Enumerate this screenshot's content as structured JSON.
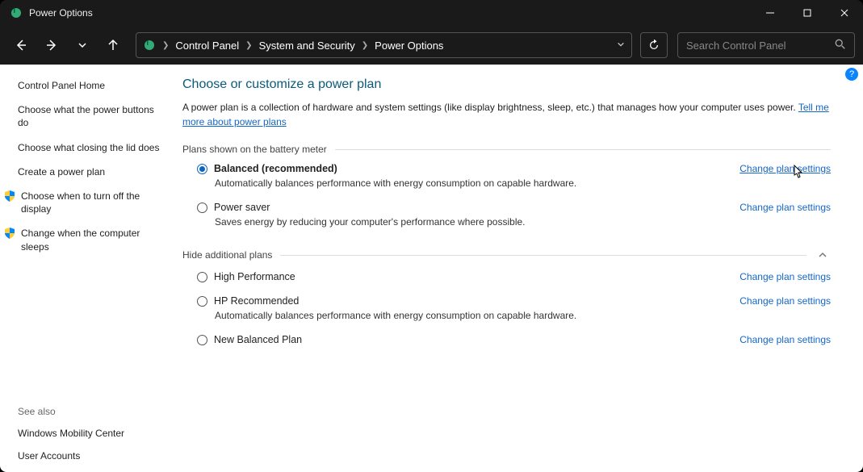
{
  "window": {
    "title": "Power Options"
  },
  "breadcrumb": {
    "items": [
      "Control Panel",
      "System and Security",
      "Power Options"
    ]
  },
  "search": {
    "placeholder": "Search Control Panel"
  },
  "sidebar": {
    "home": "Control Panel Home",
    "links": [
      "Choose what the power buttons do",
      "Choose what closing the lid does",
      "Create a power plan",
      "Choose when to turn off the display",
      "Change when the computer sleeps"
    ],
    "seealso_label": "See also",
    "seealso": [
      "Windows Mobility Center",
      "User Accounts"
    ]
  },
  "main": {
    "heading": "Choose or customize a power plan",
    "intro_prefix": "A power plan is a collection of hardware and system settings (like display brightness, sleep, etc.) that manages how your computer uses power. ",
    "intro_link": "Tell me more about power plans",
    "section1": "Plans shown on the battery meter",
    "section2": "Hide additional plans",
    "change_label": "Change plan settings",
    "plans_primary": [
      {
        "name": "Balanced (recommended)",
        "desc": "Automatically balances performance with energy consumption on capable hardware.",
        "selected": true
      },
      {
        "name": "Power saver",
        "desc": "Saves energy by reducing your computer's performance where possible.",
        "selected": false
      }
    ],
    "plans_additional": [
      {
        "name": "High Performance",
        "desc": "",
        "selected": false
      },
      {
        "name": "HP Recommended",
        "desc": "Automatically balances performance with energy consumption on capable hardware.",
        "selected": false
      },
      {
        "name": "New Balanced Plan",
        "desc": "",
        "selected": false
      }
    ]
  },
  "help": "?"
}
